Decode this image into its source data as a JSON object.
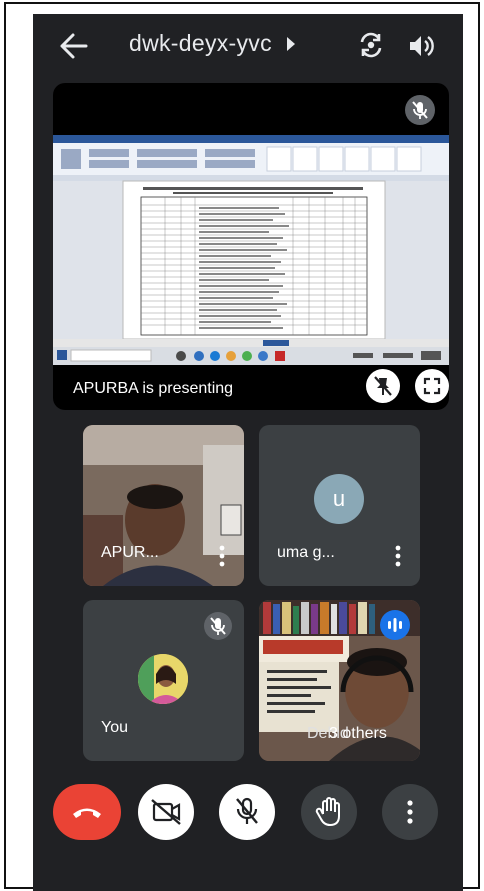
{
  "meeting": {
    "code": "dwk-deyx-yvc"
  },
  "presentation": {
    "label": "APURBA is presenting"
  },
  "participants": [
    {
      "name": "APUR...",
      "avatar_letter": ""
    },
    {
      "name": "uma g...",
      "avatar_letter": "u"
    },
    {
      "name": "You",
      "avatar_letter": ""
    },
    {
      "name": "Debid",
      "avatar_letter": ""
    }
  ],
  "others": {
    "label": "3 others"
  },
  "colors": {
    "background": "#202124",
    "end_call": "#ea4335",
    "audio_badge": "#1a73e8",
    "tile": "#3c4043"
  },
  "icons": {
    "back": "arrow-left",
    "switch_camera": "camera-flip",
    "speaker": "volume-on",
    "mic_off": "microphone-off",
    "unpin": "pin-off",
    "fullscreen": "fullscreen",
    "end_call": "phone-hangup",
    "camera_off": "video-off",
    "raise_hand": "hand",
    "more": "more-vert"
  }
}
